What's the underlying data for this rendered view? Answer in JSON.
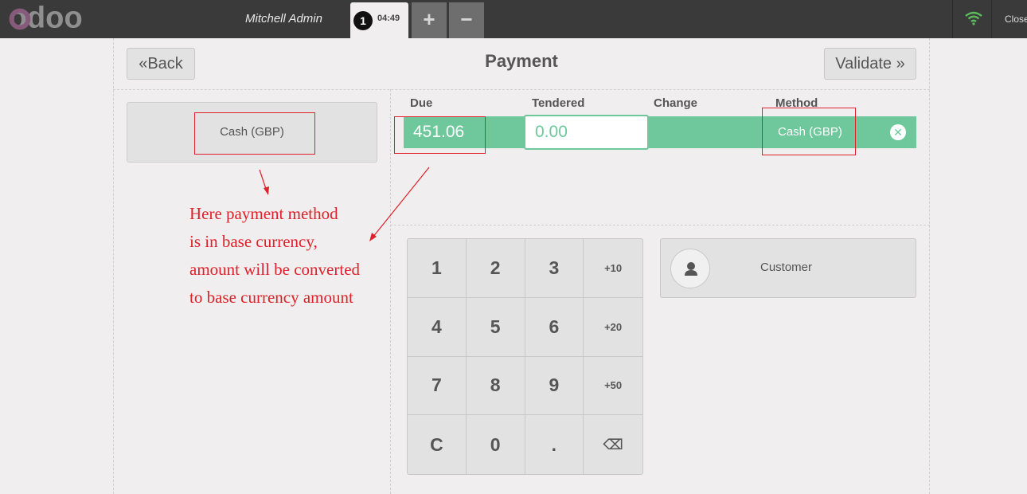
{
  "topbar": {
    "logo_text": "odoo",
    "user_name": "Mitchell Admin",
    "order_number": "1",
    "order_time": "04:49",
    "add_symbol": "+",
    "remove_symbol": "−",
    "close_label": "Close",
    "wifi_icon": "wifi-icon",
    "wifi_color": "#5cb85c",
    "logo_color": "#875a7b"
  },
  "header": {
    "back_label": "Back",
    "back_icon": "«",
    "title": "Payment",
    "validate_label": "Validate",
    "validate_icon": "»"
  },
  "payment_methods": [
    {
      "label": "Cash (GBP)"
    }
  ],
  "paymentlines": {
    "columns": [
      "Due",
      "Tendered",
      "Change",
      "Method"
    ],
    "rows": [
      {
        "due": "451.06",
        "tendered": "0.00",
        "change": "",
        "method": "Cash (GBP)"
      }
    ]
  },
  "numpad": {
    "keys": [
      "1",
      "2",
      "3",
      "+10",
      "4",
      "5",
      "6",
      "+20",
      "7",
      "8",
      "9",
      "+50",
      "C",
      "0",
      ".",
      "⌫"
    ]
  },
  "customer": {
    "label": "Customer",
    "icon": "user-icon"
  },
  "annotation": {
    "lines": [
      "Here payment method",
      "is in base currency,",
      "amount will be converted",
      "to base currency amount"
    ],
    "color": "#e0202a"
  },
  "colors": {
    "accent": "#6ec89b",
    "topbar": "#3a3a3a",
    "background": "#f0eeee"
  }
}
